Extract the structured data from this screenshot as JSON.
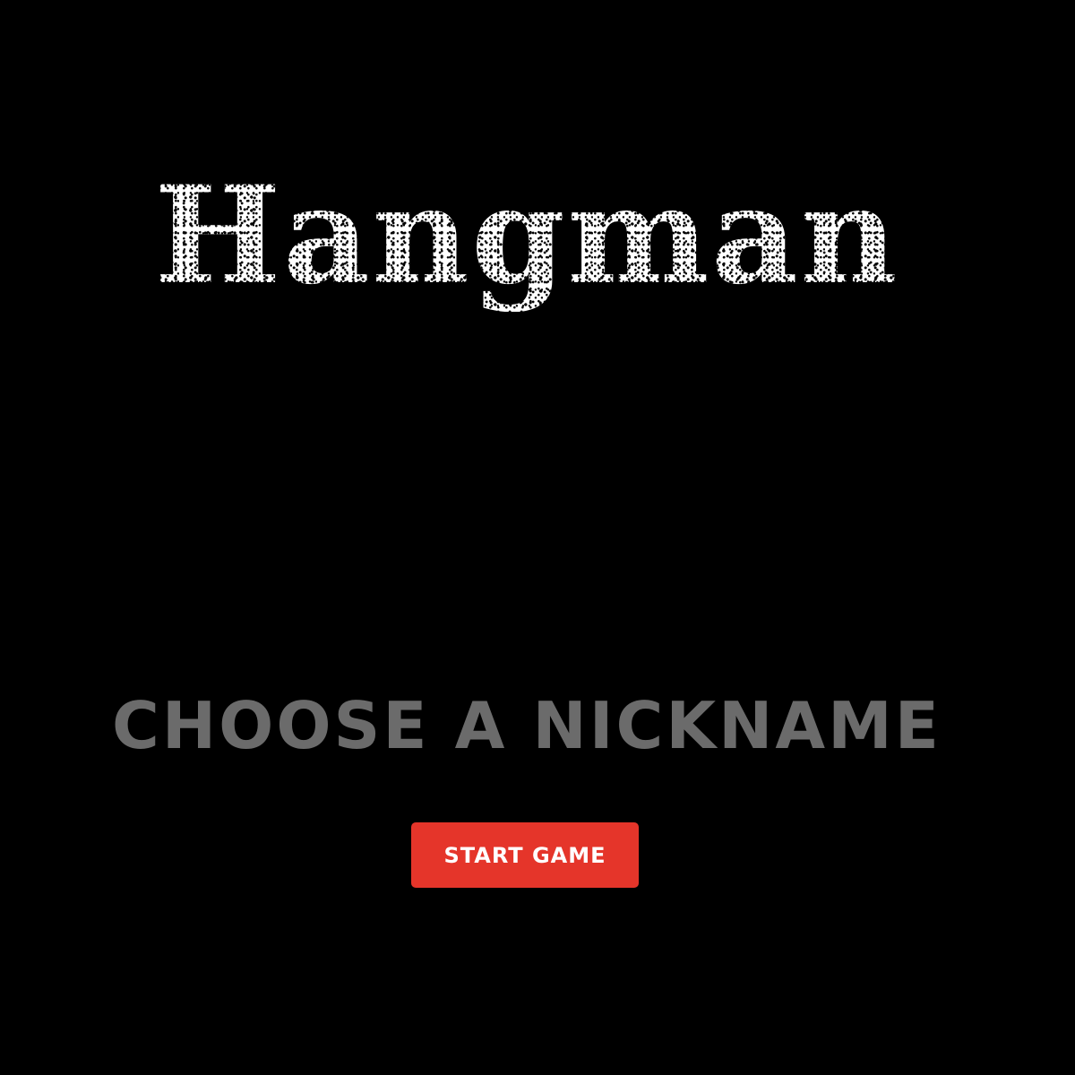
{
  "game": {
    "title": "Hangman"
  },
  "nickname": {
    "placeholder": "CHOOSE A NICKNAME",
    "value": ""
  },
  "start_button": {
    "label": "START GAME"
  },
  "colors": {
    "background": "#000000",
    "title": "#ffffff",
    "placeholder": "#6b6b6b",
    "button": "#e5352a",
    "button_text": "#ffffff"
  }
}
